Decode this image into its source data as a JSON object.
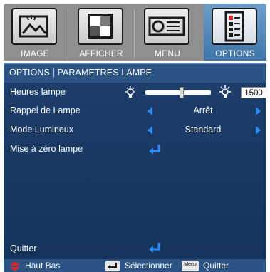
{
  "tabs": [
    {
      "label": "IMAGE",
      "icon": "image-icon",
      "active": false
    },
    {
      "label": "AFFICHER",
      "icon": "display-icon",
      "active": false
    },
    {
      "label": "MENU",
      "icon": "projector-icon",
      "active": false
    },
    {
      "label": "OPTIONS",
      "icon": "options-icon",
      "active": true
    }
  ],
  "header": {
    "title": "OPTIONS | PARAMETRES LAMPE"
  },
  "rows": {
    "lamp_hours": {
      "label": "Heures lampe",
      "value": "1500",
      "level": 0.55
    },
    "lamp_reminder": {
      "label": "Rappel de Lampe",
      "value": "Arrêt"
    },
    "brightness_mode": {
      "label": "Mode Lumineux",
      "value": "Standard"
    },
    "lamp_reset": {
      "label": "Mise à zéro lampe"
    },
    "quit": {
      "label": "Quitter"
    }
  },
  "footer": {
    "nav_label": "Haut Bas",
    "select_label": "Sélectionner",
    "menu_key": "Menu",
    "quit_label": "Quitter"
  },
  "colors": {
    "accent_blue": "#2f8cff",
    "panel_bg": "#1d3e6a",
    "header_bg": "#2b5485",
    "nav_red": "#e0242a"
  }
}
